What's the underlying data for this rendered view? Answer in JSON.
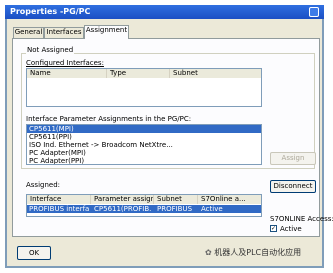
{
  "window": {
    "title": "Properties -PG/PC",
    "tabs": [
      {
        "label": "General"
      },
      {
        "label": "Interfaces"
      },
      {
        "label": "Assignment"
      }
    ]
  },
  "not_assigned": {
    "group_label": "Not Assigned",
    "configured_label": "Configured Interfaces:",
    "columns": [
      "Name",
      "Type",
      "Subnet"
    ]
  },
  "param_assign": {
    "label": "Interface Parameter Assignments in the PG/PC:",
    "items": [
      "CP5611(MPI)",
      "CP5611(PPI)",
      "ISO Ind. Ethernet -> Broadcom NetXtre...",
      "PC Adapter(MPI)",
      "PC Adapter(PPI)"
    ],
    "selected_index": 0,
    "assign_button": "Assign"
  },
  "assigned": {
    "label": "Assigned:",
    "columns": [
      "Interface",
      "Parameter assign...",
      "Subnet",
      "S7Online a..."
    ],
    "rows": [
      {
        "interface": "PROFIBUS interface",
        "param": "CP5611(PROFIB...",
        "subnet": "PROFIBUS",
        "status": "Active"
      }
    ],
    "disconnect_button": "Disconnect",
    "s7online_label": "S7ONLINE Access:",
    "active_label": "Active",
    "active_checked": true
  },
  "footer": {
    "ok_button": "OK",
    "watermark": "机器人及PLC自动化应用"
  }
}
